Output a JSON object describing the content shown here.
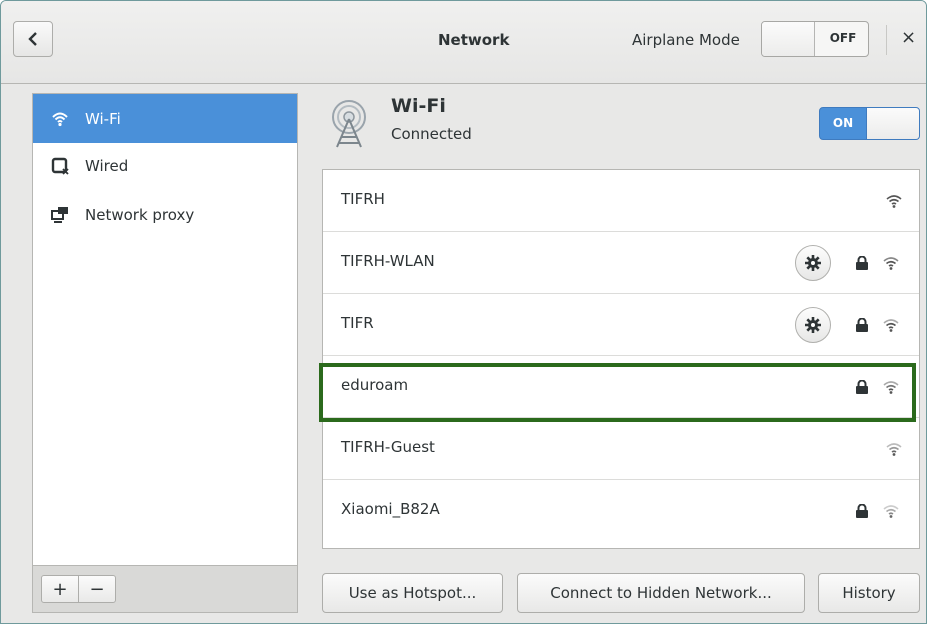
{
  "header": {
    "title": "Network",
    "airplane_label": "Airplane Mode",
    "airplane_state": "OFF",
    "close_glyph": "×",
    "back_glyph": "<"
  },
  "sidebar": {
    "items": [
      {
        "label": "Wi-Fi",
        "icon": "wifi-icon",
        "selected": true
      },
      {
        "label": "Wired",
        "icon": "wired-icon",
        "selected": false
      },
      {
        "label": "Network proxy",
        "icon": "network-proxy-icon",
        "selected": false
      }
    ],
    "add_glyph": "+",
    "remove_glyph": "−"
  },
  "wifi": {
    "heading": "Wi-Fi",
    "status": "Connected",
    "toggle_state": "ON"
  },
  "networks": [
    {
      "name": "TIFRH",
      "gear": false,
      "lock": false
    },
    {
      "name": "TIFRH-WLAN",
      "gear": true,
      "lock": true
    },
    {
      "name": "TIFR",
      "gear": true,
      "lock": true
    },
    {
      "name": "eduroam",
      "gear": false,
      "lock": true,
      "highlighted": true
    },
    {
      "name": "TIFRH-Guest",
      "gear": false,
      "lock": false
    },
    {
      "name": "Xiaomi_B82A",
      "gear": false,
      "lock": true
    }
  ],
  "buttons": {
    "hotspot": "Use as Hotspot...",
    "hidden": "Connect to Hidden Network...",
    "history": "History"
  },
  "colors": {
    "accent": "#4a90d9",
    "highlight_border": "#2b6a1c"
  }
}
